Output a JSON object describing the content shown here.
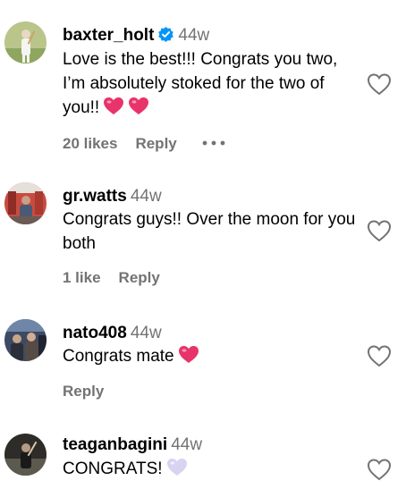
{
  "comments": [
    {
      "username": "baxter_holt",
      "verified": true,
      "time": "44w",
      "text": "Love is the best!!! Congrats you two, I’m absolutely stoked for the two of you!!",
      "likes": "20 likes",
      "reply": "Reply",
      "emoji": [
        "heart-emoji",
        "heart-emoji"
      ]
    },
    {
      "username": "gr.watts",
      "time": "44w",
      "text": "Congrats guys!! Over the moon for you both",
      "likes": "1 like",
      "reply": "Reply"
    },
    {
      "username": "nato408",
      "time": "44w",
      "text": "Congrats mate",
      "reply": "Reply",
      "emoji": [
        "heart-emoji"
      ]
    },
    {
      "username": "teaganbagini",
      "time": "44w",
      "text": "CONGRATS!",
      "emoji": [
        "white-heart-emoji"
      ]
    }
  ],
  "colors": {
    "verified_badge": "#0095f6",
    "muted_text": "#737373",
    "heart_emoji": "#e8336b",
    "white_heart_emoji": "#d9d2f0"
  },
  "icons": {
    "like": "heart-outline-icon",
    "more": "more-options-icon",
    "verified": "verified-badge-icon"
  }
}
